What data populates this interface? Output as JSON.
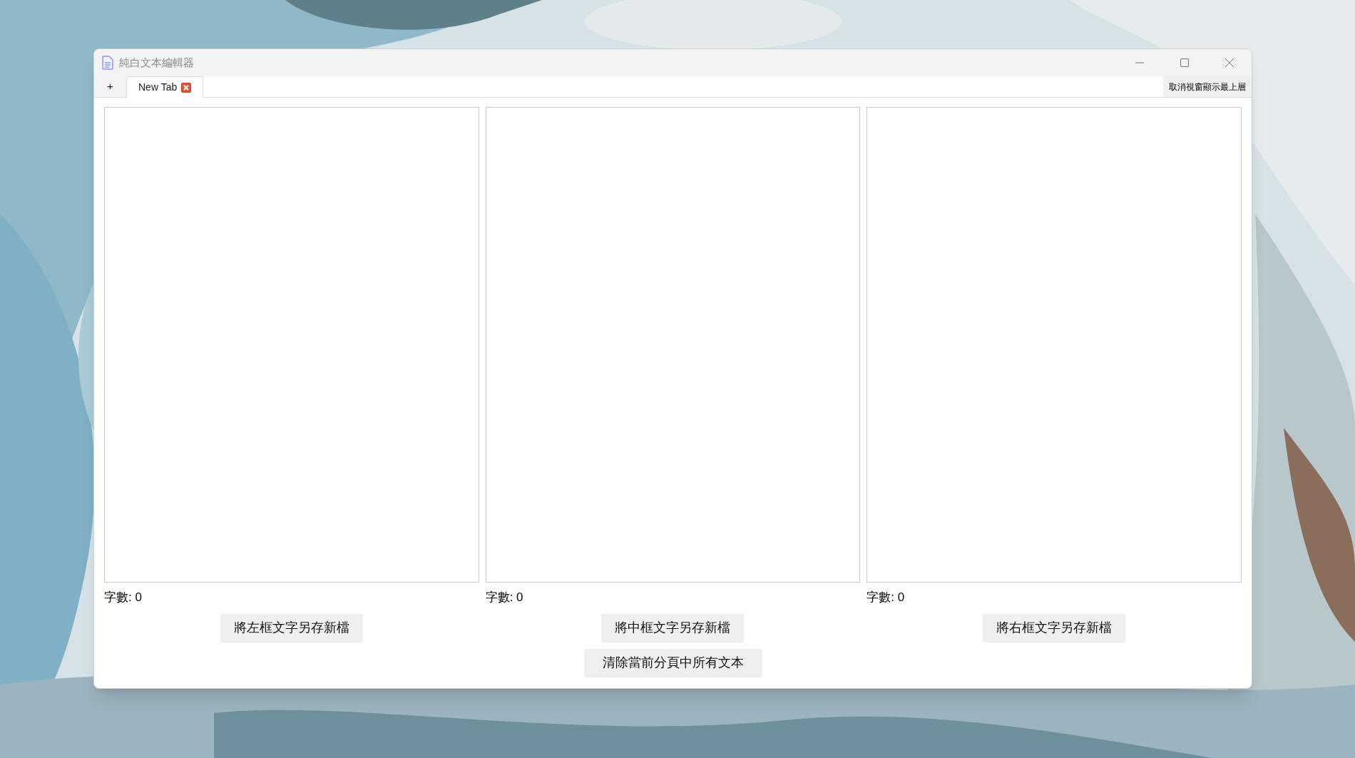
{
  "window": {
    "title": "純白文本編輯器"
  },
  "new_tab_button": "+",
  "tabs": [
    {
      "label": "New Tab",
      "selected": true
    }
  ],
  "topmost_button": "取消視窗顯示最上層",
  "panels": [
    {
      "count": "字數: 0",
      "save_button": "將左框文字另存新檔"
    },
    {
      "count": "字數: 0",
      "save_button": "將中框文字另存新檔"
    },
    {
      "count": "字數: 0",
      "save_button": "將右框文字另存新檔"
    }
  ],
  "clear_button": "清除當前分頁中所有文本"
}
